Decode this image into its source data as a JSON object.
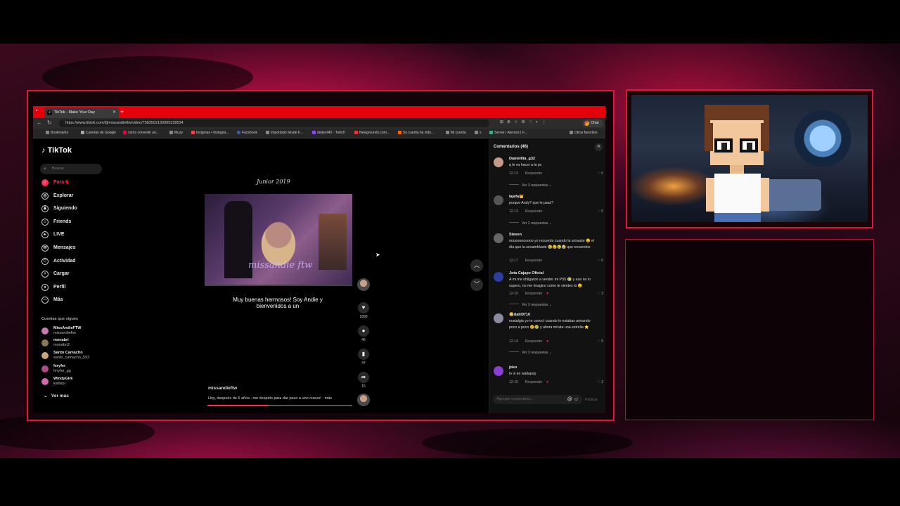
{
  "browser": {
    "tab_title": "TikTok - Make Your Day",
    "new_tab": "+",
    "url": "https://www.tiktok.com/@missandieftw/video/7583502130095328534",
    "chat_label": "Chat",
    "bookmarks": [
      "Bookmarks",
      "Cuentas de Google",
      "como convertir un...",
      "Muzy",
      "Insignias • Instagra...",
      "Facebook",
      "Importado desde F...",
      "dedevil42 - Twitch",
      "Newgrounds.com...",
      "Su cuenta ha sido...",
      "Mi cuenta",
      "s",
      "Server | Aternos | F...",
      "Otros favoritos"
    ]
  },
  "tiktok": {
    "logo": "TikTok",
    "search_placeholder": "Buscar",
    "nav": [
      "Para ti",
      "Explorar",
      "Siguiendo",
      "Friends",
      "LIVE",
      "Mensajes",
      "Actividad",
      "Cargar",
      "Perfil",
      "Más"
    ],
    "following_title": "Cuentas que sigues",
    "following": [
      {
        "name": "MissAndieFTW",
        "handle": "missandieftw"
      },
      {
        "name": "monabri",
        "handle": "monabri2"
      },
      {
        "name": "Santo Camacho",
        "handle": "santo_camacho_593"
      },
      {
        "name": "feryfer",
        "handle": "feryfer_gg"
      },
      {
        "name": "WindyGirk",
        "handle": "katlispi"
      }
    ],
    "see_more": "Ver más"
  },
  "video": {
    "signature": "Junior 2019",
    "watermark": "missandie ftw",
    "caption": "Muy buenas hermosos! Soy Andie y bienvenidos a un",
    "username": "missandieftw",
    "description": "Hoy, después de 6 años...me despido para dar paso a uno nuevo! · más",
    "progress": 0.42,
    "likes": "1899",
    "comments": "46",
    "saves": "47",
    "shares": "15"
  },
  "comments": {
    "title": "Comentarios (46)",
    "input_placeholder": "Agregar comentario...",
    "post_label": "Publicar",
    "reply_label": "Responder",
    "items": [
      {
        "user": "Daniellita_g32",
        "text": "q le va hacer a la pc",
        "date": "12-13",
        "likes": "0",
        "replies": "Ver 3 respuestas ⌄"
      },
      {
        "user": "lajefa👑",
        "text": "porque Andy? que le pasó?",
        "date": "12-13",
        "likes": "0",
        "replies": "Ver 2 respuestas ⌄"
      },
      {
        "user": "Steven",
        "text": "nooooooooooo yo recuerdo cuando la armaste 😢 el día que la ensamblaste 😢😢😢😢 que recuerdos",
        "date": "12-17",
        "likes": "0",
        "replies": ""
      },
      {
        "user": "Jota Cajape Oficial",
        "text": "A mi me obligaron a vender mi PS5 😢 y aún no lo supero, no me imagino como te sientes tú 😢",
        "date": "12-15",
        "likes": "2",
        "replies": "Ver 3 respuestas ⌄"
      },
      {
        "user": "😊dalil0710",
        "text": "nostalgia yo te conocí cuando lo estabas armando poco a poco 😢😢 y ahora mírate una estrella ⭐",
        "date": "12-14",
        "likes": "5",
        "replies": "Ver 3 respuestas ⌄"
      },
      {
        "user": "joko",
        "text": "lo vi en wallapop",
        "date": "12-15",
        "likes": "2",
        "replies": ""
      }
    ]
  },
  "colors": {
    "accent": "#fe2c55",
    "frame": "#e0143c",
    "tabbar": "#e3000b"
  }
}
